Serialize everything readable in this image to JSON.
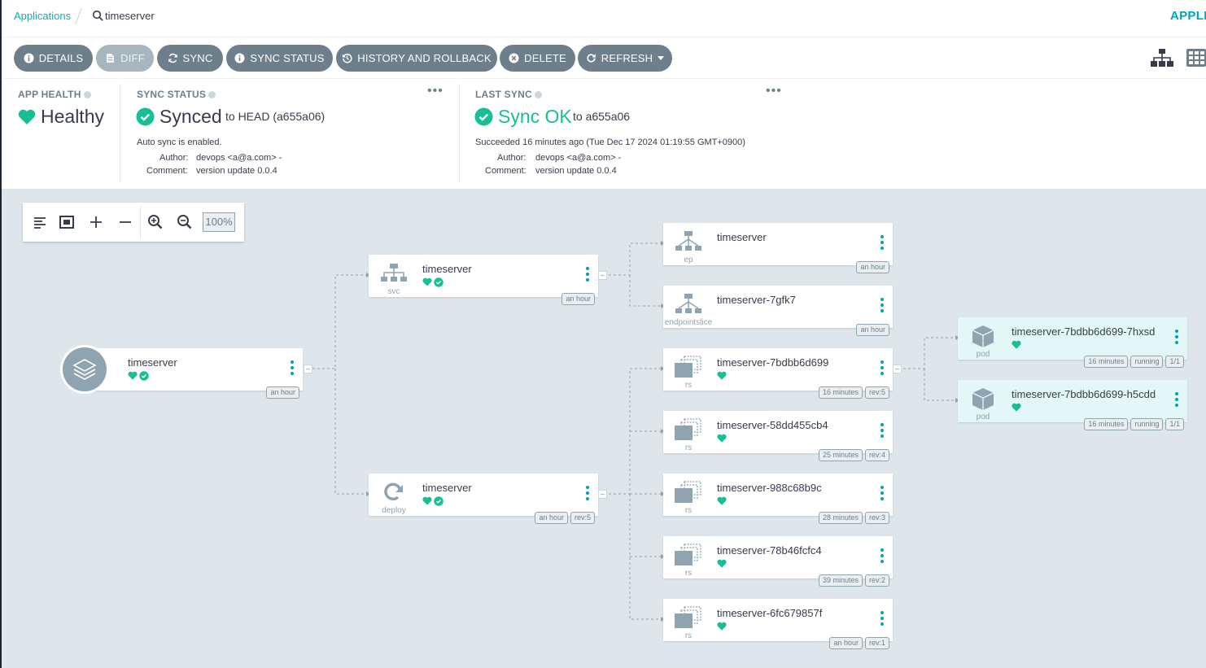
{
  "breadcrumb": {
    "applications": "Applications",
    "app_name": "timeserver"
  },
  "top_right_label": "APPLIC",
  "toolbar": {
    "details": "DETAILS",
    "diff": "DIFF",
    "sync": "SYNC",
    "sync_status": "SYNC STATUS",
    "history": "HISTORY AND ROLLBACK",
    "delete": "DELETE",
    "refresh": "REFRESH"
  },
  "app_health": {
    "title": "APP HEALTH",
    "value": "Healthy",
    "color": "#18be94"
  },
  "sync_status": {
    "title": "SYNC STATUS",
    "value": "Synced",
    "target": "to HEAD (a655a06)",
    "auto_sync": "Auto sync is enabled.",
    "author_label": "Author:",
    "author": "devops <a@a.com> -",
    "comment_label": "Comment:",
    "comment": "version update 0.0.4"
  },
  "last_sync": {
    "title": "LAST SYNC",
    "value": "Sync OK",
    "target": "to a655a06",
    "succeeded": "Succeeded 16 minutes ago (Tue Dec 17 2024 01:19:55 GMT+0900)",
    "author_label": "Author:",
    "author": "devops <a@a.com> -",
    "comment_label": "Comment:",
    "comment": "version update 0.0.4"
  },
  "zoom": {
    "level": "100%"
  },
  "nodes": {
    "app": {
      "name": "timeserver",
      "tags": [
        "an hour"
      ]
    },
    "svc": {
      "name": "timeserver",
      "kind": "svc",
      "tags": [
        "an hour"
      ]
    },
    "deploy": {
      "name": "timeserver",
      "kind": "deploy",
      "tags": [
        "an hour",
        "rev:5"
      ]
    },
    "ep": {
      "name": "timeserver",
      "kind": "ep",
      "tags": [
        "an hour"
      ]
    },
    "eps": {
      "name": "timeserver-7gfk7",
      "kind": "endpointslice",
      "tags": [
        "an hour"
      ]
    },
    "rs5": {
      "name": "timeserver-7bdbb6d699",
      "kind": "rs",
      "tags": [
        "16 minutes",
        "rev:5"
      ]
    },
    "rs4": {
      "name": "timeserver-58dd455cb4",
      "kind": "rs",
      "tags": [
        "25 minutes",
        "rev:4"
      ]
    },
    "rs3": {
      "name": "timeserver-988c68b9c",
      "kind": "rs",
      "tags": [
        "28 minutes",
        "rev:3"
      ]
    },
    "rs2": {
      "name": "timeserver-78b46fcfc4",
      "kind": "rs",
      "tags": [
        "39 minutes",
        "rev:2"
      ]
    },
    "rs1": {
      "name": "timeserver-6fc679857f",
      "kind": "rs",
      "tags": [
        "an hour",
        "rev:1"
      ]
    },
    "pod1": {
      "name": "timeserver-7bdbb6d699-7hxsd",
      "kind": "pod",
      "tags": [
        "16 minutes",
        "running",
        "1/1"
      ]
    },
    "pod2": {
      "name": "timeserver-7bdbb6d699-h5cdd",
      "kind": "pod",
      "tags": [
        "16 minutes",
        "running",
        "1/1"
      ]
    }
  },
  "colors": {
    "accent": "#00a2b3",
    "healthy": "#18be94",
    "button": "#6d7f8b"
  }
}
